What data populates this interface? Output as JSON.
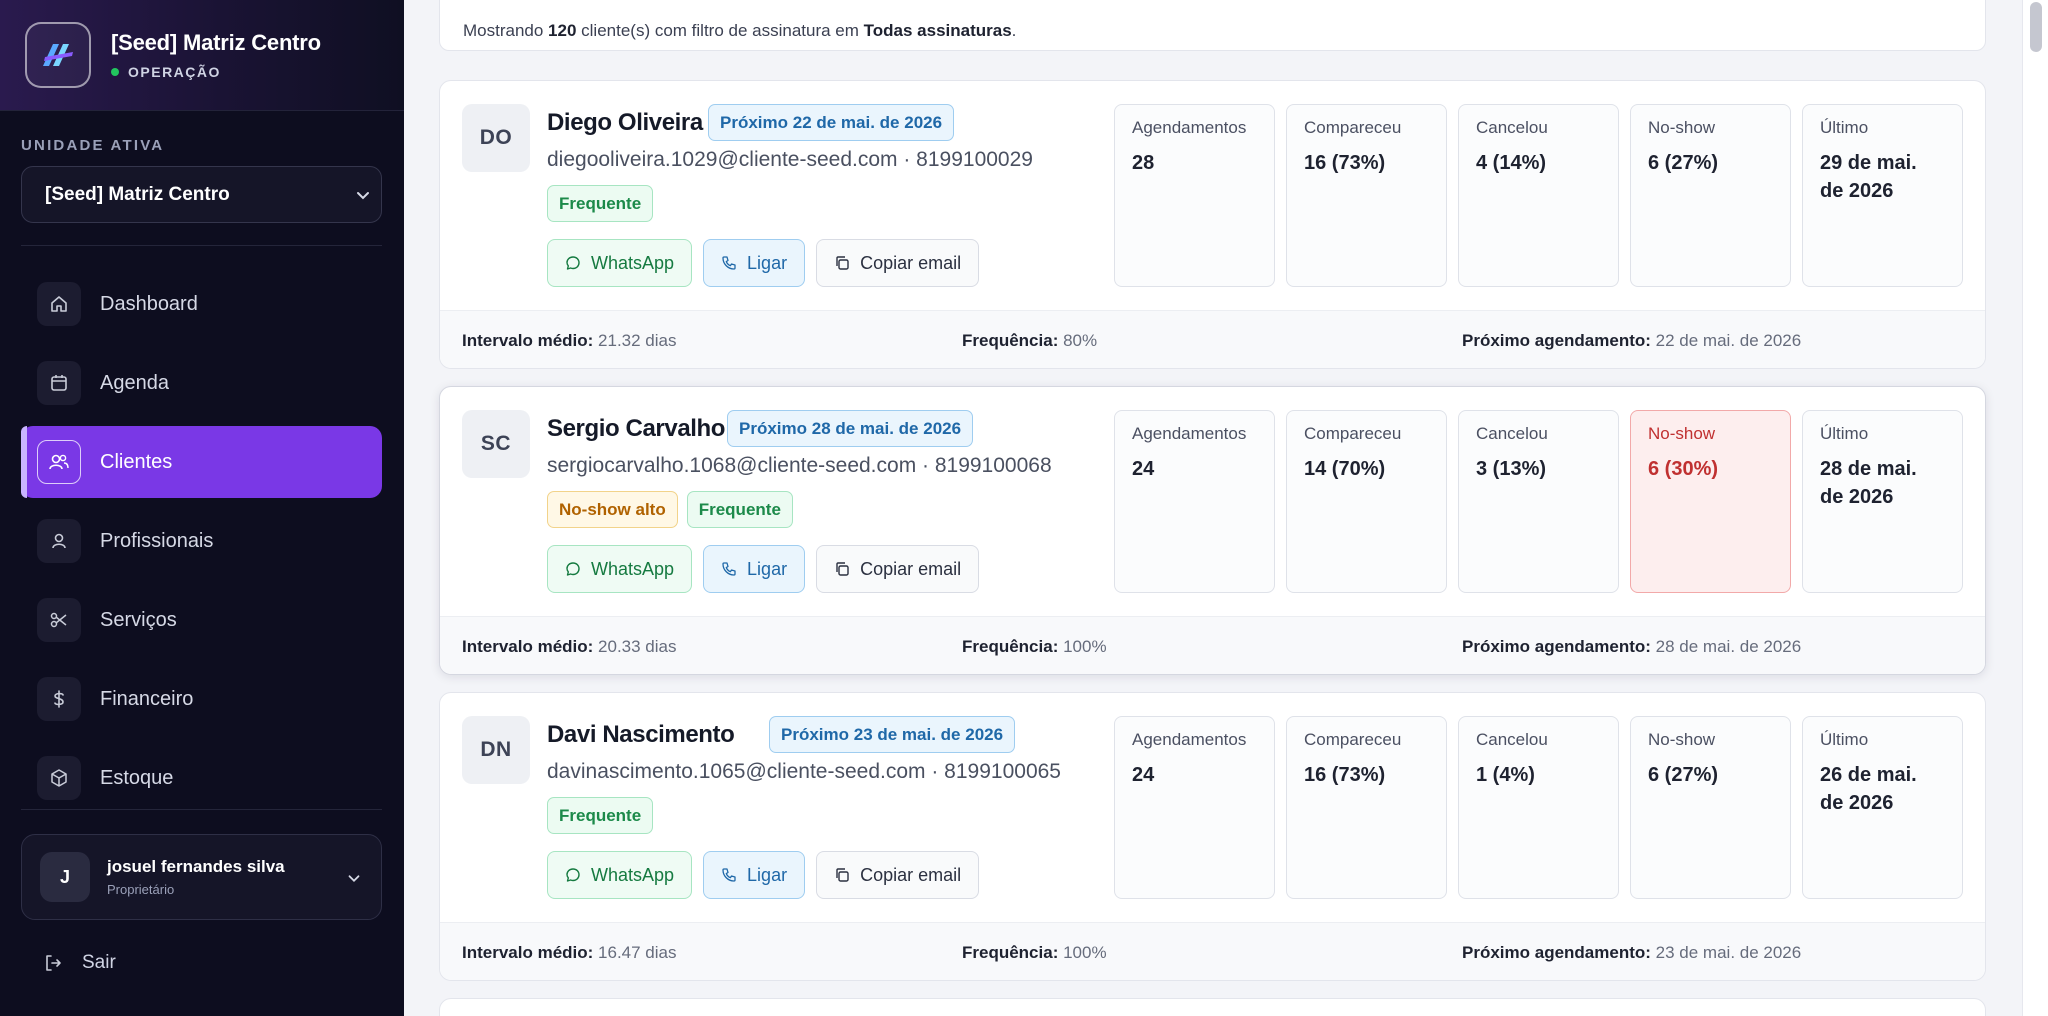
{
  "brand": {
    "title": "[Seed] Matriz Centro",
    "status": "OPERAÇÃO"
  },
  "sidebar": {
    "unit_label": "UNIDADE ATIVA",
    "unit_value": "[Seed] Matriz Centro",
    "items": [
      {
        "label": "Dashboard",
        "icon": "home-icon"
      },
      {
        "label": "Agenda",
        "icon": "calendar-icon"
      },
      {
        "label": "Clientes",
        "icon": "users-icon",
        "active": true
      },
      {
        "label": "Profissionais",
        "icon": "user-icon"
      },
      {
        "label": "Serviços",
        "icon": "scissors-icon"
      },
      {
        "label": "Financeiro",
        "icon": "dollar-icon"
      },
      {
        "label": "Estoque",
        "icon": "box-icon"
      }
    ],
    "user": {
      "initial": "J",
      "name": "josuel fernandes silva",
      "role": "Proprietário"
    },
    "logout": "Sair"
  },
  "summary": {
    "prefix": "Mostrando ",
    "count": "120",
    "middle": " cliente(s) com filtro de assinatura em ",
    "filter": "Todas assinaturas",
    "suffix": "."
  },
  "labels": {
    "whatsapp": "WhatsApp",
    "call": "Ligar",
    "copy_email": "Copiar email",
    "stat_appointments": "Agendamentos",
    "stat_attended": "Compareceu",
    "stat_cancelled": "Cancelou",
    "stat_noshow": "No-show",
    "stat_last": "Último",
    "footer_interval": "Intervalo médio:",
    "footer_frequency": "Frequência:",
    "footer_next": "Próximo agendamento:"
  },
  "clients": [
    {
      "initials": "DO",
      "name": "Diego Oliveira",
      "next_badge": "Próximo 22 de mai. de 2026",
      "contact": "diegooliveira.1029@cliente-seed.com · 8199100029",
      "tag_noshow": "",
      "tag_frequent": "Frequente",
      "appointments": "28",
      "attended": "16 (73%)",
      "cancelled": "4 (14%)",
      "noshow": "6 (27%)",
      "last": "29 de mai. de 2026",
      "interval": "21.32 dias",
      "frequency": "80%",
      "next_appointment": "22 de mai. de 2026"
    },
    {
      "initials": "SC",
      "name": "Sergio Carvalho",
      "next_badge": "Próximo 28 de mai. de 2026",
      "contact": "sergiocarvalho.1068@cliente-seed.com · 8199100068",
      "tag_noshow": "No-show alto",
      "tag_frequent": "Frequente",
      "appointments": "24",
      "attended": "14 (70%)",
      "cancelled": "3 (13%)",
      "noshow": "6 (30%)",
      "last": "28 de mai. de 2026",
      "interval": "20.33 dias",
      "frequency": "100%",
      "next_appointment": "28 de mai. de 2026"
    },
    {
      "initials": "DN",
      "name": "Davi Nascimento",
      "next_badge": "Próximo 23 de mai. de 2026",
      "contact": "davinascimento.1065@cliente-seed.com · 8199100065",
      "tag_noshow": "",
      "tag_frequent": "Frequente",
      "appointments": "24",
      "attended": "16 (73%)",
      "cancelled": "1 (4%)",
      "noshow": "6 (27%)",
      "last": "26 de mai. de 2026",
      "interval": "16.47 dias",
      "frequency": "100%",
      "next_appointment": "23 de mai. de 2026"
    }
  ],
  "colors": {
    "accent": "#7a38e6",
    "sidebar_bg": "#0d0d1f",
    "success": "#1c8a4a",
    "info": "#1f68a8",
    "danger": "#c03030",
    "warning": "#b06200"
  }
}
